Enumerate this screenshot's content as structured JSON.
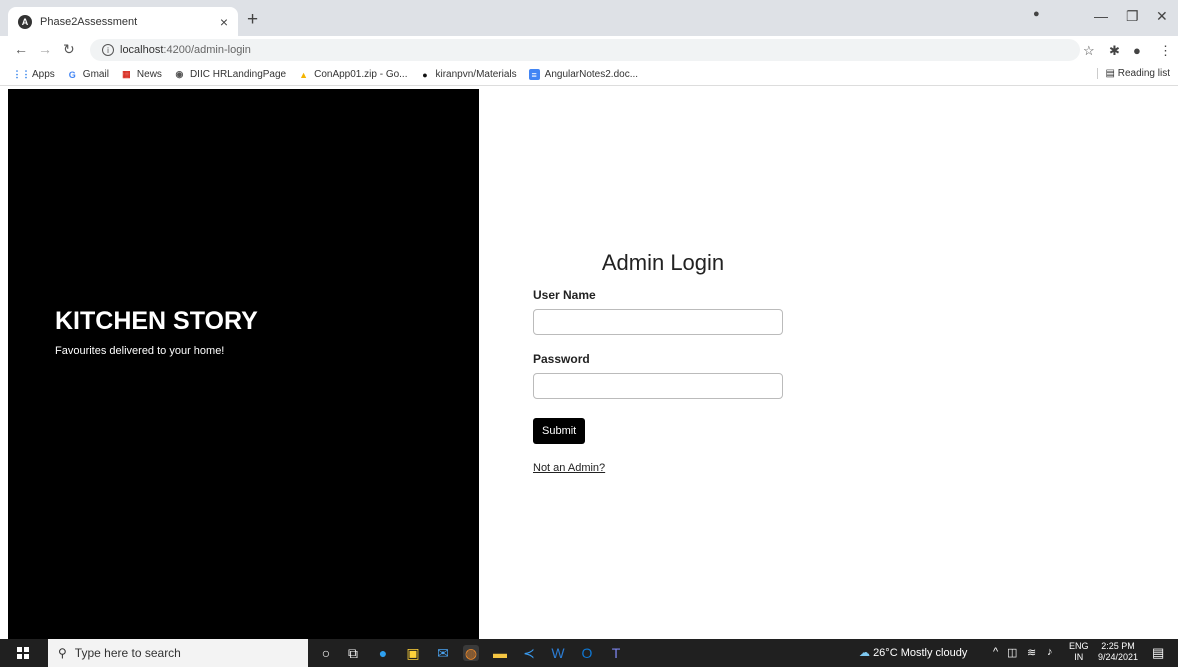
{
  "browser": {
    "tab_title": "Phase2Assessment",
    "tab_close": "×",
    "new_tab": "+",
    "url_host": "localhost",
    "url_path": ":4200/admin-login",
    "bookmarks": [
      {
        "label": "Apps",
        "icon": "apps-grid-icon"
      },
      {
        "label": "Gmail",
        "icon": "google-icon"
      },
      {
        "label": "News",
        "icon": "news-icon"
      },
      {
        "label": "DIIC HRLandingPage",
        "icon": "globe-icon"
      },
      {
        "label": "ConApp01.zip - Go...",
        "icon": "drive-icon"
      },
      {
        "label": "kiranpvn/Materials",
        "icon": "github-icon"
      },
      {
        "label": "AngularNotes2.doc...",
        "icon": "docs-icon"
      }
    ],
    "reading_list": "Reading list"
  },
  "hero": {
    "brand": "KITCHEN STORY",
    "tagline": "Favourites delivered to your home!"
  },
  "login": {
    "title": "Admin Login",
    "username_label": "User Name",
    "username_value": "",
    "password_label": "Password",
    "password_value": "",
    "submit_label": "Submit",
    "not_admin_link": "Not an Admin?"
  },
  "taskbar": {
    "search_placeholder": "Type here to search",
    "weather": "26°C  Mostly cloudy",
    "lang_top": "ENG",
    "lang_bottom": "IN",
    "time": "2:25 PM",
    "date": "9/24/2021"
  }
}
